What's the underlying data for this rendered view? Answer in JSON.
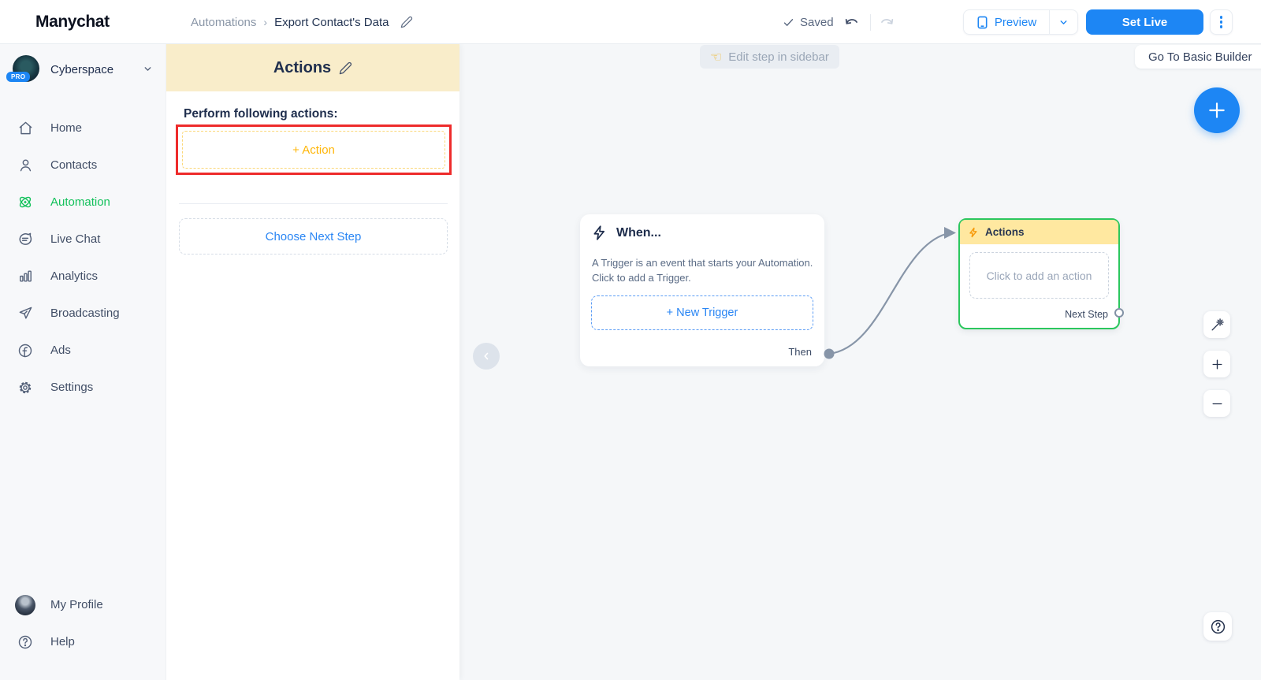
{
  "topbar": {
    "logo": "Manychat",
    "breadcrumb": {
      "parent": "Automations",
      "separator": "›",
      "current": "Export Contact's Data"
    },
    "saved_label": "Saved",
    "preview_label": "Preview",
    "set_live_label": "Set Live"
  },
  "sidebar": {
    "workspace": {
      "name": "Cyberspace",
      "badge": "PRO"
    },
    "items": [
      {
        "label": "Home",
        "icon": "home-icon",
        "active": false
      },
      {
        "label": "Contacts",
        "icon": "contacts-icon",
        "active": false
      },
      {
        "label": "Automation",
        "icon": "automation-icon",
        "active": true
      },
      {
        "label": "Live Chat",
        "icon": "live-chat-icon",
        "active": false
      },
      {
        "label": "Analytics",
        "icon": "analytics-icon",
        "active": false
      },
      {
        "label": "Broadcasting",
        "icon": "broadcasting-icon",
        "active": false
      },
      {
        "label": "Ads",
        "icon": "ads-icon",
        "active": false
      },
      {
        "label": "Settings",
        "icon": "settings-icon",
        "active": false
      }
    ],
    "footer_items": [
      {
        "label": "My Profile",
        "icon": "profile-avatar"
      },
      {
        "label": "Help",
        "icon": "help-icon"
      }
    ]
  },
  "panel": {
    "title": "Actions",
    "subtitle": "Perform following actions:",
    "add_action_label": "+ Action",
    "choose_next_step_label": "Choose Next Step"
  },
  "canvas": {
    "edit_hint": "Edit step in sidebar",
    "edit_hint_icon_char": "☜",
    "go_to_basic_builder_label": "Go To Basic Builder",
    "trigger_card": {
      "title": "When...",
      "description_line1": "A Trigger is an event that starts your Automation.",
      "description_line2": "Click to add a Trigger.",
      "new_trigger_label": "+ New Trigger",
      "then_label": "Then"
    },
    "actions_node": {
      "title": "Actions",
      "placeholder": "Click to add an action",
      "next_step_label": "Next Step"
    }
  },
  "colors": {
    "accent_blue": "#1d86f4",
    "brand_green": "#13c15b",
    "node_border_green": "#2bc75e",
    "panel_header_cream": "#f9edca",
    "node_header_yellow": "#ffe8a0",
    "action_orange": "#ffb608",
    "annotation_red": "#ee2b2b",
    "connector_gray": "#8795a8"
  }
}
